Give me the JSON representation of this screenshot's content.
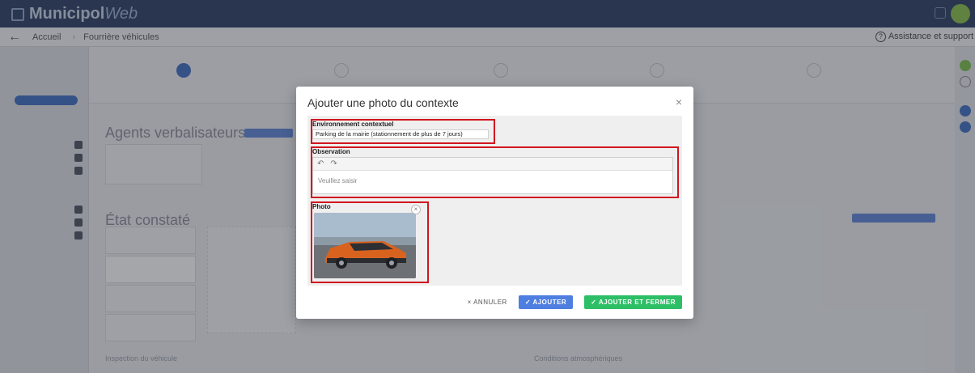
{
  "app": {
    "brand_main": "Municipol",
    "brand_suffix": "Web"
  },
  "nav": {
    "home": "Accueil",
    "page": "Fourrière véhicules",
    "assistance": "Assistance et support"
  },
  "background": {
    "section_agents": "Agents verbalisateurs",
    "section_etat": "État constaté",
    "conditions": "Conditions atmosphériques",
    "inspection": "Inspection du véhicule"
  },
  "modal": {
    "title": "Ajouter une photo du contexte",
    "environment": {
      "label": "Environnement contextuel",
      "value": "Parking de la mairie (stationnement de plus de 7 jours)"
    },
    "observation": {
      "label": "Observation",
      "placeholder": "Veuillez saisir",
      "undo": "↶",
      "redo": "↷"
    },
    "photo": {
      "label": "Photo",
      "remove": "×"
    },
    "buttons": {
      "cancel": "× ANNULER",
      "add": "✓ AJOUTER",
      "add_close": "✓ AJOUTER ET FERMER"
    }
  },
  "colors": {
    "highlight": "#d1161f",
    "primary": "#4e7ee0",
    "success": "#2dbf66"
  }
}
